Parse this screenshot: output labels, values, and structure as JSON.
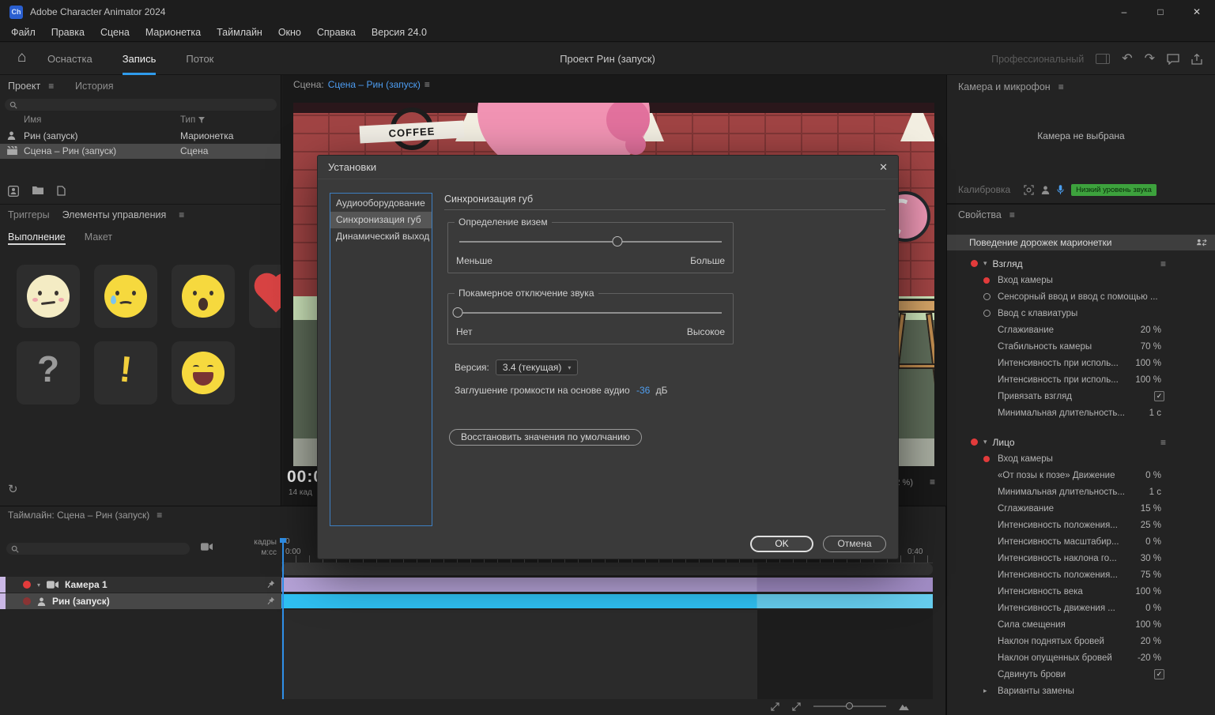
{
  "icons": {
    "hamburger": "≡",
    "chev_down": "▾",
    "chev_right": "▸",
    "sort_down": "▼",
    "close": "✕",
    "minimize": "–",
    "maximize": "□",
    "home": "⌂",
    "undo": "↶",
    "redo": "↷",
    "refresh": "↻",
    "check": "✓"
  },
  "titlebar": {
    "logo": "Ch",
    "title": "Adobe Character Animator 2024"
  },
  "menu": {
    "items": [
      "Файл",
      "Правка",
      "Сцена",
      "Марионетка",
      "Таймлайн",
      "Окно",
      "Справка",
      "Версия 24.0"
    ]
  },
  "workspace": {
    "tabs": [
      {
        "label": "Оснастка",
        "active": false
      },
      {
        "label": "Запись",
        "active": true
      },
      {
        "label": "Поток",
        "active": false
      }
    ],
    "project_title": "Проект Рин (запуск)",
    "mode_label": "Профессиональный"
  },
  "project_panel": {
    "tab_project": "Проект",
    "tab_history": "История",
    "col_name": "Имя",
    "col_type": "Тип",
    "rows": [
      {
        "icon": "puppet",
        "name": "Рин (запуск)",
        "type": "Марионетка",
        "selected": false
      },
      {
        "icon": "scene",
        "name": "Сцена – Рин (запуск)",
        "type": "Сцена",
        "selected": true
      }
    ]
  },
  "triggers_panel": {
    "tab_triggers": "Триггеры",
    "tab_controls": "Элементы управления",
    "tab_perform": "Выполнение",
    "tab_layout": "Макет",
    "tiles": [
      {
        "kind": "worried"
      },
      {
        "kind": "sad"
      },
      {
        "kind": "surprised"
      },
      {
        "kind": "heart"
      },
      {
        "kind": "question",
        "glyph": "?"
      },
      {
        "kind": "exclaim",
        "glyph": "!"
      },
      {
        "kind": "smile"
      }
    ]
  },
  "scene_panel": {
    "label_prefix": "Сцена:",
    "scene_link": "Сцена – Рин (запуск)",
    "sign_text": "COFFEE",
    "timecode": "00:0",
    "frame_info": "14 кад",
    "zoom": "(2 %)"
  },
  "dialog": {
    "title": "Установки",
    "categories": [
      {
        "label": "Аудиооборудование",
        "selected": false
      },
      {
        "label": "Синхронизация губ",
        "selected": true
      },
      {
        "label": "Динамический выход",
        "selected": false
      }
    ],
    "section_title": "Синхронизация губ",
    "groups": [
      {
        "title": "Определение визем",
        "min_label": "Меньше",
        "max_label": "Больше",
        "value": 60
      },
      {
        "title": "Покамерное отключение звука",
        "min_label": "Нет",
        "max_label": "Высокое",
        "value": 0
      }
    ],
    "version_label": "Версия:",
    "version_value": "3.4 (текущая)",
    "mute_label": "Заглушение громкости на основе аудио",
    "mute_value": "-36",
    "mute_unit": "дБ",
    "reset_label": "Восстановить значения по умолчанию",
    "ok_label": "OK",
    "cancel_label": "Отмена"
  },
  "camera_panel": {
    "title": "Камера и микрофон",
    "empty": "Камера не выбрана",
    "calibrate": "Калибровка",
    "badge": "Низкий уровень звука"
  },
  "properties_panel": {
    "title": "Свойства",
    "section": "Поведение дорожек марионетки",
    "groups": [
      {
        "name": "Взгляд",
        "items": [
          {
            "label": "Вход камеры",
            "icon": "record"
          },
          {
            "label": "Сенсорный ввод и ввод с помощью ...",
            "icon": "radio"
          },
          {
            "label": "Ввод с клавиатуры",
            "icon": "radio"
          },
          {
            "label": "Сглаживание",
            "value": "20 %"
          },
          {
            "label": "Стабильность камеры",
            "value": "70 %"
          },
          {
            "label": "Интенсивность при исполь...",
            "value": "100 %"
          },
          {
            "label": "Интенсивность при исполь...",
            "value": "100 %"
          },
          {
            "label": "Привязать взгляд",
            "checkbox": true
          },
          {
            "label": "Минимальная длительность...",
            "value": "1 с"
          }
        ]
      },
      {
        "name": "Лицо",
        "items": [
          {
            "label": "Вход камеры",
            "icon": "record"
          },
          {
            "label": "«От позы к позе»  Движение",
            "value": "0 %"
          },
          {
            "label": "Минимальная длительность...",
            "value": "1 с"
          },
          {
            "label": "Сглаживание",
            "value": "15 %"
          },
          {
            "label": "Интенсивность положения...",
            "value": "25 %"
          },
          {
            "label": "Интенсивность масштабир...",
            "value": "0 %"
          },
          {
            "label": "Интенсивность наклона го...",
            "value": "30 %"
          },
          {
            "label": "Интенсивность положения...",
            "value": "75 %"
          },
          {
            "label": "Интенсивность века",
            "value": "100 %"
          },
          {
            "label": "Интенсивность движения ...",
            "value": "0 %"
          },
          {
            "label": "Сила смещения",
            "value": "100 %"
          },
          {
            "label": "Наклон поднятых бровей",
            "value": "20 %"
          },
          {
            "label": "Наклон опущенных бровей",
            "value": "-20 %"
          },
          {
            "label": "Сдвинуть брови",
            "checkbox": true
          },
          {
            "label": "Варианты замены",
            "chevron": true
          }
        ]
      }
    ]
  },
  "timeline": {
    "title": "Таймлайн: Сцена – Рин (запуск)",
    "frames_label": "кадры",
    "time_label": "м:сс",
    "ruler": {
      "frames_start": "0",
      "time_start": "0:00",
      "time_end": "0:40"
    },
    "tracks": [
      {
        "name": "Камера 1",
        "color": "#b6a3d8",
        "color2": "#a28dc6"
      },
      {
        "name": "Рин (запуск)",
        "color": "#2fc0f2",
        "color2": "#66cdee"
      }
    ]
  }
}
